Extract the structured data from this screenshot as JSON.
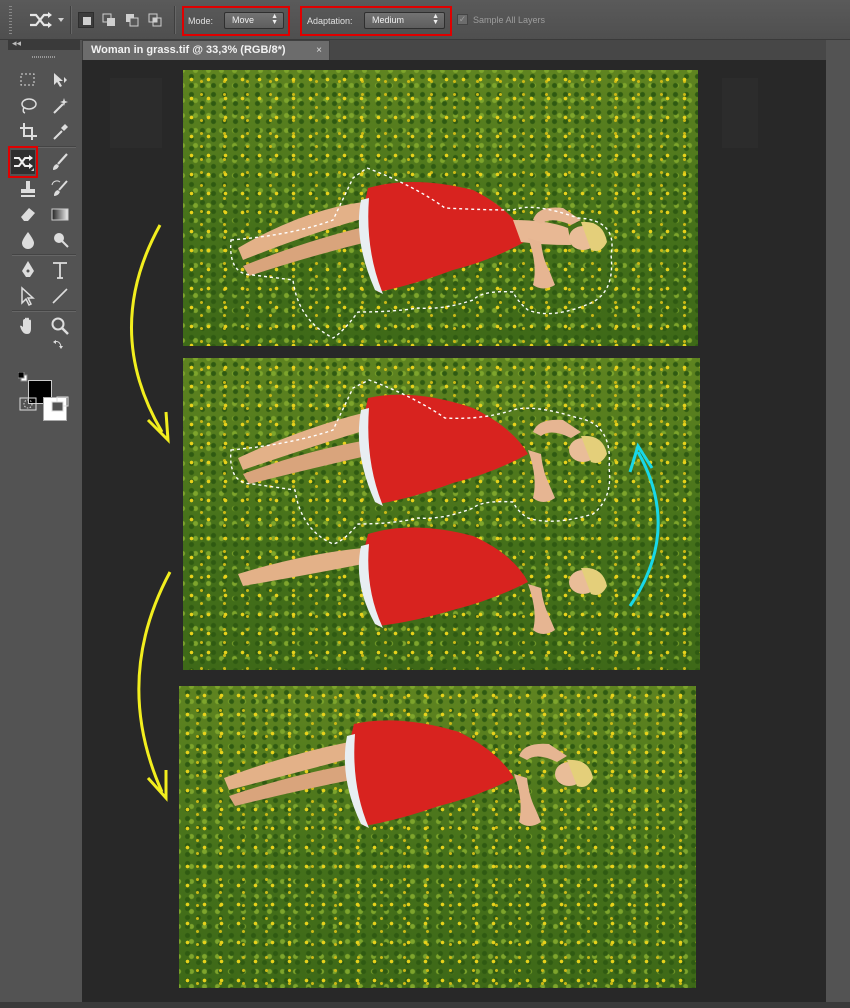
{
  "options_bar": {
    "mode_label": "Mode:",
    "mode_value": "Move",
    "adaptation_label": "Adaptation:",
    "adaptation_value": "Medium",
    "sample_all_layers_label": "Sample All Layers",
    "sample_all_layers_checked": true
  },
  "document": {
    "tab_title": "Woman in grass.tif @ 33,3% (RGB/8*)",
    "close_glyph": "×"
  },
  "toolbar": {
    "collapse_glyph": "◂◂",
    "active_tool": "content-aware-move-tool"
  },
  "annotation_colors": {
    "highlight_box": "#e00000",
    "down_arrow": "#f2ee1e",
    "up_arrow": "#18d8e8",
    "selection_marquee": "#ffffff"
  },
  "panels": [
    {
      "step": 1,
      "description_visible": false
    },
    {
      "step": 2,
      "description_visible": false
    },
    {
      "step": 3,
      "description_visible": false
    }
  ]
}
